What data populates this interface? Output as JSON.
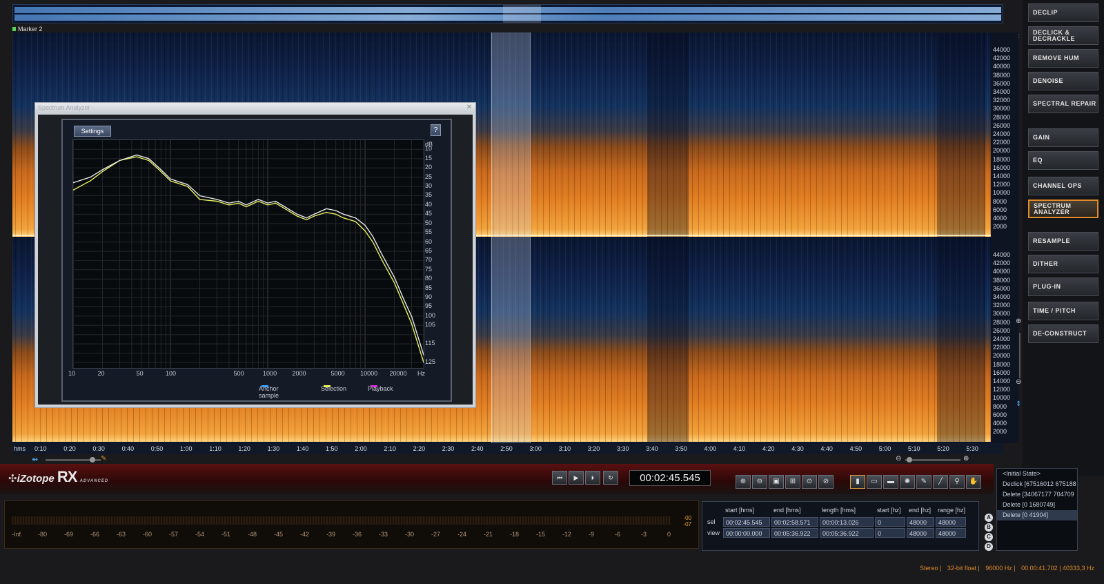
{
  "app": {
    "brand": "iZotope",
    "product": "RX",
    "edition": "ADVANCED"
  },
  "marker": {
    "label": "Marker 2"
  },
  "spectrogram": {
    "hz_unit": "Hz",
    "hz_ticks": [
      "44000",
      "42000",
      "40000",
      "38000",
      "36000",
      "34000",
      "32000",
      "30000",
      "28000",
      "26000",
      "24000",
      "22000",
      "20000",
      "18000",
      "16000",
      "14000",
      "12000",
      "10000",
      "8000",
      "6000",
      "4000",
      "2000"
    ],
    "time_unit": "hms",
    "time_ticks": [
      "0:10",
      "0:20",
      "0:30",
      "0:40",
      "0:50",
      "1:00",
      "1:10",
      "1:20",
      "1:30",
      "1:40",
      "1:50",
      "2:00",
      "2:10",
      "2:20",
      "2:30",
      "2:40",
      "2:50",
      "3:00",
      "3:10",
      "3:20",
      "3:30",
      "3:40",
      "3:50",
      "4:00",
      "4:10",
      "4:20",
      "4:30",
      "4:40",
      "4:50",
      "5:00",
      "5:10",
      "5:20",
      "5:30"
    ]
  },
  "modules": [
    {
      "label": "DECLIP",
      "active": false
    },
    {
      "label": "DECLICK & DECRACKLE",
      "active": false
    },
    {
      "label": "REMOVE HUM",
      "active": false
    },
    {
      "label": "DENOISE",
      "active": false
    },
    {
      "label": "SPECTRAL REPAIR",
      "active": false
    },
    {
      "label": "GAIN",
      "active": false
    },
    {
      "label": "EQ",
      "active": false
    },
    {
      "label": "CHANNEL OPS",
      "active": false
    },
    {
      "label": "SPECTRUM ANALYZER",
      "active": true
    },
    {
      "label": "RESAMPLE",
      "active": false
    },
    {
      "label": "DITHER",
      "active": false
    },
    {
      "label": "PLUG-IN",
      "active": false
    },
    {
      "label": "TIME / PITCH",
      "active": false
    },
    {
      "label": "DE-CONSTRUCT",
      "active": false
    }
  ],
  "spectrum_analyzer": {
    "title": "Spectrum Analyzer",
    "settings_label": "Settings",
    "help_label": "?",
    "db_unit": "dB",
    "db_ticks": [
      "10",
      "15",
      "20",
      "25",
      "30",
      "35",
      "40",
      "45",
      "50",
      "55",
      "60",
      "65",
      "70",
      "75",
      "80",
      "85",
      "90",
      "95",
      "100",
      "105",
      "115",
      "125"
    ],
    "freq_unit": "Hz",
    "freq_ticks": [
      "10",
      "20",
      "50",
      "100",
      "500",
      "1000",
      "2000",
      "5000",
      "10000",
      "20000"
    ],
    "legend": [
      {
        "label": "Anchor sample",
        "color": "#3aa0ff"
      },
      {
        "label": "Selection",
        "color": "#e8f060"
      },
      {
        "label": "Playback",
        "color": "#d030d0"
      }
    ],
    "chart_data": {
      "type": "line",
      "x_scale": "log",
      "xlabel": "Hz",
      "ylabel": "dB",
      "ylim": [
        5,
        128
      ],
      "xlim": [
        10,
        40000
      ],
      "series": [
        {
          "name": "Selection",
          "color": "#e8f060",
          "x": [
            10,
            15,
            20,
            30,
            45,
            60,
            80,
            100,
            150,
            200,
            300,
            400,
            500,
            600,
            800,
            1000,
            1200,
            1500,
            2000,
            2500,
            3000,
            4000,
            5000,
            6000,
            8000,
            10000,
            12000,
            15000,
            20000,
            25000,
            30000,
            40000
          ],
          "y": [
            32,
            27,
            22,
            16,
            14,
            16,
            22,
            27,
            30,
            37,
            38,
            40,
            39,
            41,
            38,
            40,
            39,
            42,
            46,
            48,
            46,
            44,
            45,
            47,
            49,
            54,
            60,
            70,
            82,
            94,
            104,
            125
          ]
        },
        {
          "name": "",
          "color": "#e6e6e6",
          "x": [
            10,
            15,
            20,
            30,
            45,
            60,
            80,
            100,
            150,
            200,
            300,
            400,
            500,
            600,
            800,
            1000,
            1200,
            1500,
            2000,
            2500,
            3000,
            4000,
            5000,
            6000,
            8000,
            10000,
            12000,
            15000,
            20000,
            25000,
            30000,
            40000
          ],
          "y": [
            28,
            25,
            21,
            16,
            13,
            15,
            21,
            26,
            29,
            35,
            37,
            39,
            38,
            40,
            37,
            39,
            38,
            41,
            45,
            47,
            45,
            42,
            43,
            45,
            47,
            51,
            57,
            67,
            79,
            91,
            100,
            121
          ]
        }
      ]
    }
  },
  "transport": {
    "timecode": "00:02:45.545"
  },
  "meter": {
    "scale": [
      "-Inf.",
      "-80",
      "-69",
      "-66",
      "-63",
      "-60",
      "-57",
      "-54",
      "-51",
      "-48",
      "-45",
      "-42",
      "-39",
      "-36",
      "-33",
      "-30",
      "-27",
      "-24",
      "-21",
      "-18",
      "-15",
      "-12",
      "-9",
      "-6",
      "-3",
      "0"
    ],
    "peak_top": "-00",
    "peak_bottom": "-07"
  },
  "selection_table": {
    "headers": [
      "start [hms]",
      "end [hms]",
      "length [hms]",
      "start [hz]",
      "end [hz]",
      "range [hz]"
    ],
    "rows": [
      {
        "label": "sel",
        "values": [
          "00:02:45.545",
          "00:02:58.571",
          "00:00:13.026",
          "0",
          "48000",
          "48000"
        ]
      },
      {
        "label": "view",
        "values": [
          "00:00:00.000",
          "00:05:36.922",
          "00:05:36.922",
          "0",
          "48000",
          "48000"
        ]
      }
    ],
    "abcd": [
      "A",
      "B",
      "C",
      "D"
    ]
  },
  "history": [
    {
      "label": "<Initial State>",
      "current": false
    },
    {
      "label": "Declick [67516012 675188",
      "current": false
    },
    {
      "label": "Delete [34067177 704709",
      "current": false
    },
    {
      "label": "Delete [0 1680749]",
      "current": false
    },
    {
      "label": "Delete [0 41904]",
      "current": true
    }
  ],
  "status": {
    "channels": "Stereo",
    "bitdepth": "32-bit float",
    "samplerate": "96000 Hz",
    "cursor": "00:00:41.702 | 40333,3 Hz"
  },
  "colors": {
    "accent": "#e08a2a",
    "selection_curve": "#e8f060"
  }
}
